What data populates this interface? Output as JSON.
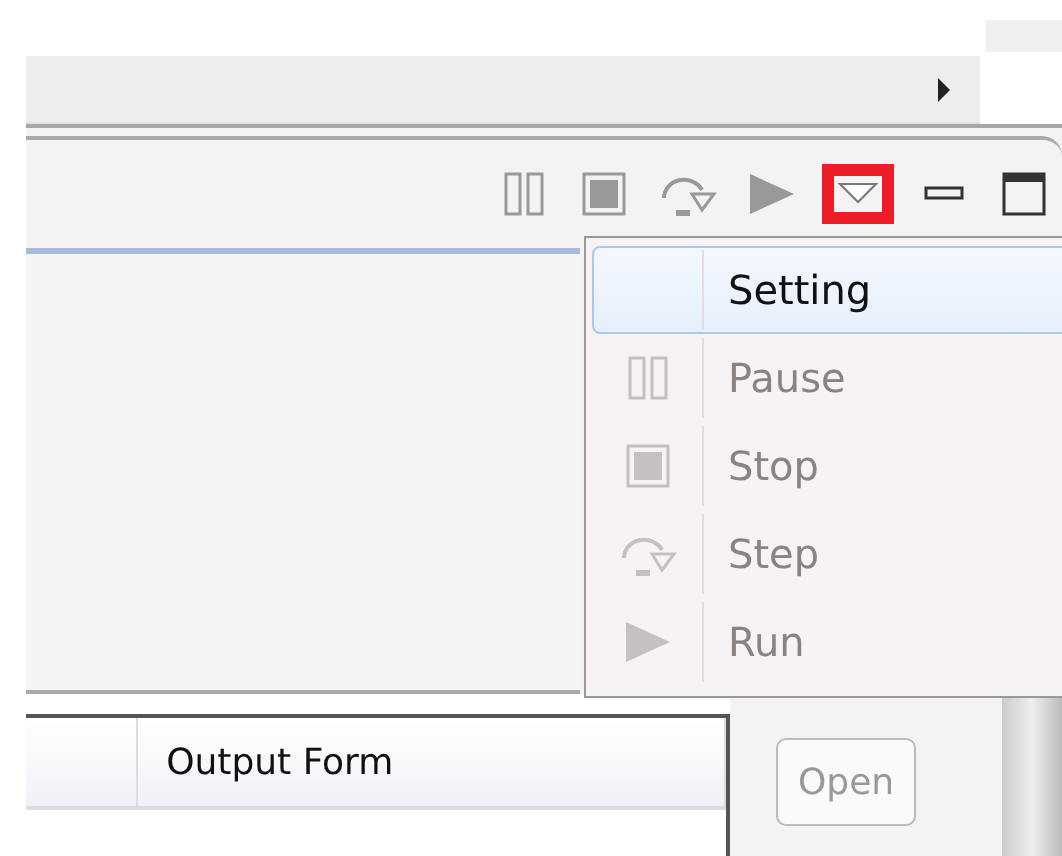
{
  "toolbar": {
    "buttons": [
      {
        "kind": "pause",
        "highlighted": false
      },
      {
        "kind": "stop",
        "highlighted": false
      },
      {
        "kind": "step",
        "highlighted": false
      },
      {
        "kind": "run",
        "highlighted": false
      },
      {
        "kind": "view-menu",
        "highlighted": true
      },
      {
        "kind": "minimize",
        "highlighted": false
      },
      {
        "kind": "maximize",
        "highlighted": false
      }
    ]
  },
  "menu": {
    "items": [
      {
        "kind": "setting",
        "label": "Setting",
        "selected": true,
        "disabled": false
      },
      {
        "kind": "pause",
        "label": "Pause",
        "selected": false,
        "disabled": true
      },
      {
        "kind": "stop",
        "label": "Stop",
        "selected": false,
        "disabled": true
      },
      {
        "kind": "step",
        "label": "Step",
        "selected": false,
        "disabled": true
      },
      {
        "kind": "run",
        "label": "Run",
        "selected": false,
        "disabled": true
      }
    ]
  },
  "table": {
    "columns": [
      "Output Form"
    ]
  },
  "open_button": {
    "label": "Open",
    "disabled": true
  }
}
